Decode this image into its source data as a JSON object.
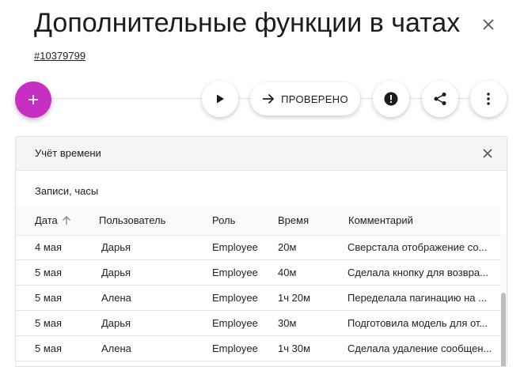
{
  "page": {
    "title": "Дополнительные функции в чатах",
    "task_id": "#10379799"
  },
  "toolbar": {
    "status_button_label": "ПРОВЕРЕНО"
  },
  "panel": {
    "title": "Учёт времени",
    "section_label": "Записи, часы",
    "columns": {
      "date": "Дата",
      "user": "Пользователь",
      "role": "Роль",
      "time": "Время",
      "comment": "Комментарий"
    },
    "rows": [
      {
        "date": "4 мая",
        "user": "Дарья",
        "role": "Employee",
        "time": "20м",
        "comment": "Сверстала отображение со..."
      },
      {
        "date": "5 мая",
        "user": "Дарья",
        "role": "Employee",
        "time": "40м",
        "comment": "Сделала кнопку для возвра..."
      },
      {
        "date": "5 мая",
        "user": "Алена",
        "role": "Employee",
        "time": "1ч 20м",
        "comment": "Переделала пагинацию на ..."
      },
      {
        "date": "5 мая",
        "user": "Дарья",
        "role": "Employee",
        "time": "30м",
        "comment": "Подготовила модель для от..."
      },
      {
        "date": "5 мая",
        "user": "Алена",
        "role": "Employee",
        "time": "1ч 30м",
        "comment": "Сделала удаление сообщен..."
      }
    ]
  },
  "icons": {
    "add": "plus-icon",
    "play": "play-icon",
    "arrow": "arrow-right-icon",
    "alert": "alert-circle-icon",
    "share": "share-icon",
    "more": "more-vertical-icon",
    "close": "close-icon",
    "sort": "arrow-up-icon"
  },
  "colors": {
    "accent": "#c62fc2",
    "header_bg": "#f5f5f5"
  }
}
